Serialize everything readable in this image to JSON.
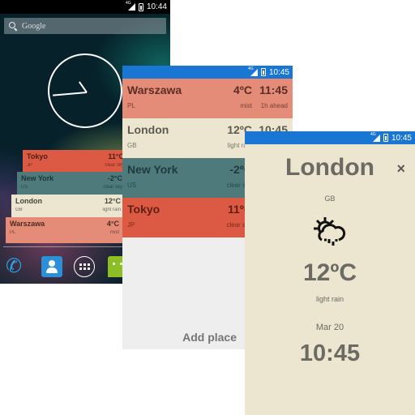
{
  "home_screen": {
    "status_bar": {
      "network": "4G",
      "time": "10:44"
    },
    "search": {
      "placeholder": "Google"
    },
    "widgets": [
      {
        "city": "Tokyo",
        "country": "JP",
        "temp": "11°C",
        "desc": "clear sky"
      },
      {
        "city": "New York",
        "country": "US",
        "temp": "-2°C",
        "desc": "clear sky"
      },
      {
        "city": "London",
        "country": "GB",
        "temp": "12°C",
        "desc": "light rain"
      },
      {
        "city": "Warszawa",
        "country": "PL",
        "temp": "4°C",
        "desc": "mist"
      }
    ],
    "dock": [
      "phone-icon",
      "contacts-icon",
      "app-drawer-icon",
      "messaging-icon"
    ]
  },
  "list_screen": {
    "status_bar": {
      "network": "4G",
      "time": "10:45"
    },
    "places": [
      {
        "city": "Warszawa",
        "country": "PL",
        "temp": "4ºC",
        "desc": "mist",
        "time": "11:45",
        "offset": "1h ahead",
        "color": "#e58c78"
      },
      {
        "city": "London",
        "country": "GB",
        "temp": "12ºC",
        "desc": "light rain",
        "time": "10:45",
        "offset": "",
        "color": "#ece6d0"
      },
      {
        "city": "New York",
        "country": "US",
        "temp": "-2ºC",
        "desc": "clear sky",
        "time": "",
        "offset": "",
        "color": "#4f7a7c"
      },
      {
        "city": "Tokyo",
        "country": "JP",
        "temp": "11ºC",
        "desc": "clear sky",
        "time": "",
        "offset": "",
        "color": "#dc5a43"
      }
    ],
    "add_place_label": "Add place"
  },
  "detail_screen": {
    "status_bar": {
      "network": "4G",
      "time": "10:45"
    },
    "city": "London",
    "country": "GB",
    "weather_icon": "sun-cloud-rain-icon",
    "temp": "12ºC",
    "desc": "light rain",
    "date": "Mar 20",
    "time": "10:45",
    "close_icon": "×",
    "background_color": "#ece6d0"
  }
}
